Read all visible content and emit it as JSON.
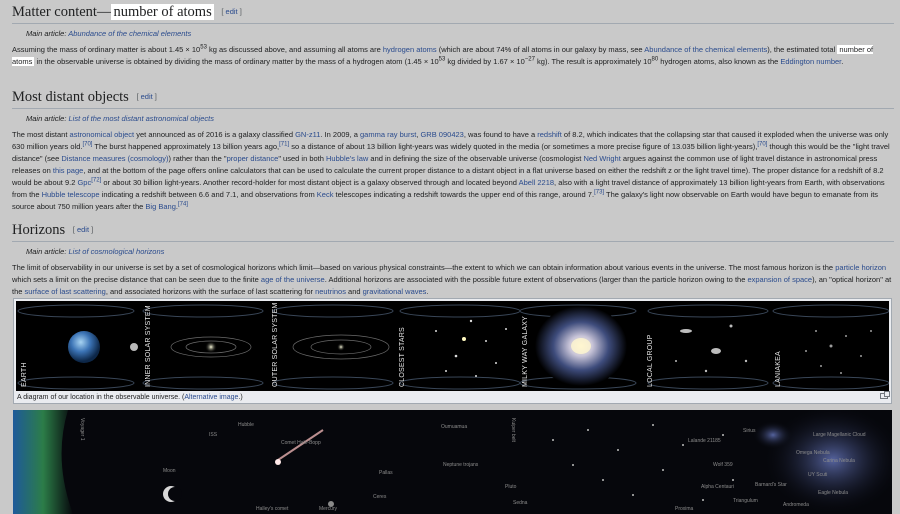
{
  "sections": {
    "matter": {
      "title_prefix": "Matter content—",
      "title_highlight": "number of atoms",
      "edit": "edit",
      "hatnote_prefix": "Main article: ",
      "hatnote_link": "Abundance of the chemical elements",
      "p1": "Assuming the mass of ordinary matter is about 1.45 × 10",
      "p1_sup1": "53",
      "p2": " kg as discussed above, and assuming all atoms are ",
      "p2_link": "hydrogen atoms",
      "p3": " (which are about 74% of all atoms in our galaxy by mass, see ",
      "p3_link": "Abundance of the chemical elements",
      "p4": "), the estimated total",
      "p5_hl": "number of atoms",
      "p6": " in the observable universe is obtained by dividing the mass of ordinary matter by the mass of a hydrogen atom (1.45 × 10",
      "p6_sup": "53",
      "p7": " kg divided by 1.67 × 10",
      "p7_sup": "−27",
      "p8": " kg). The result is approximately 10",
      "p8_sup": "80",
      "p9": " hydrogen atoms, also known as the ",
      "p9_link": "Eddington number",
      "p10": "."
    },
    "distant": {
      "title": "Most distant objects",
      "edit": "edit",
      "hatnote_prefix": "Main article: ",
      "hatnote_link": "List of the most distant astronomical objects",
      "t1": "The most distant ",
      "l1": "astronomical object",
      "t2": " yet announced as of 2016 is a galaxy classified ",
      "l2": "GN-z11",
      "t3": ". In 2009, a ",
      "l3": "gamma ray burst",
      "t4": ", ",
      "l4": "GRB 090423",
      "t5": ", was found to have a ",
      "l5": "redshift",
      "t6": " of 8.2, which indicates that the collapsing star that caused it exploded when the universe was only 630 million years old.",
      "r1": "[70]",
      "t7": " The burst happened approximately 13 billion years ago,",
      "r2": "[71]",
      "t8": " so a distance of about 13 billion light-years was widely quoted in the media (or sometimes a more precise figure of 13.035 billion light-years),",
      "r3": "[70]",
      "t9": " though this would be the \"light travel distance\" (see ",
      "l6": "Distance measures (cosmology)",
      "t10": ") rather than the \"",
      "l7": "proper distance",
      "t11": "\" used in both ",
      "l8": "Hubble's law",
      "t12": " and in defining the size of the observable universe (cosmologist ",
      "l9": "Ned Wright",
      "t13": " argues against the common use of light travel distance in astronomical press releases on ",
      "l10": "this page",
      "t14": ", and at the bottom of the page offers online calculators that can be used to calculate the current proper distance to a distant object in a flat universe based on either the redshift z or the light travel time). The proper distance for a redshift of 8.2 would be about 9.2 ",
      "l11": "Gpc",
      "r4": "[72]",
      "t15": " or about 30 billion light-years. Another record-holder for most distant object is a galaxy observed through and located beyond ",
      "l12": "Abell 2218",
      "t16": ", also with a light travel distance of approximately 13 billion light-years from Earth, with observations from the ",
      "l13": "Hubble telescope",
      "t17": " indicating a redshift between 6.6 and 7.1, and observations from ",
      "l14": "Keck",
      "t18": " telescopes indicating a redshift towards the upper end of this range, around 7.",
      "r5": "[73]",
      "t19": " The galaxy's light now observable on Earth would have begun to emanate from its source about 750 million years after the ",
      "l15": "Big Bang",
      "t20": ".",
      "r6": "[74]"
    },
    "horizons": {
      "title": "Horizons",
      "edit": "edit",
      "hatnote_prefix": "Main article: ",
      "hatnote_link": "List of cosmological horizons",
      "t1": "The limit of observability in our universe is set by a set of cosmological horizons which limit—based on various physical constraints—the extent to which we can obtain information about various events in the universe. The most famous horizon is the ",
      "l1": "particle horizon",
      "t2": " which sets a limit on the precise distance that can be seen due to the finite ",
      "l2": "age of the universe",
      "t3": ". Additional horizons are associated with the possible future extent of observations (larger than the particle horizon owing to the ",
      "l3": "expansion of space",
      "t4": "), an \"optical horizon\" at the ",
      "l4": "surface of last scattering",
      "t5": ", and associated horizons with the surface of last scattering for ",
      "l5": "neutrinos",
      "t6": " and ",
      "l6": "gravitational waves",
      "t7": "."
    }
  },
  "figure": {
    "panels": [
      "EARTH",
      "INNER SOLAR SYSTEM",
      "OUTER SOLAR SYSTEM",
      "CLOSEST STARS",
      "MILKY WAY GALAXY",
      "LOCAL GROUP",
      "LANIAKEA"
    ],
    "caption_prefix": "A diagram of our location in the observable universe. (",
    "caption_link": "Alternative image",
    "caption_suffix": ".)"
  },
  "big_image": {
    "labels": [
      "Moon",
      "Comet Hale-Bopp",
      "Halley's comet",
      "Mercury",
      "Pallas",
      "Ceres",
      "Pluto",
      "Sedna",
      "Oumuamua",
      "Neptune trojans",
      "Kuiper belt",
      "Andromeda",
      "Triangulum",
      "Large Magellanic Cloud",
      "Omega Nebula",
      "Carina Nebula",
      "Eagle Nebula",
      "UY Scuti",
      "Proxima",
      "Sirius",
      "Lalande 21185",
      "Wolf 359",
      "Barnard's Star",
      "Alpha Centauri",
      "Voyager 1",
      "ISS",
      "Hubble"
    ]
  }
}
